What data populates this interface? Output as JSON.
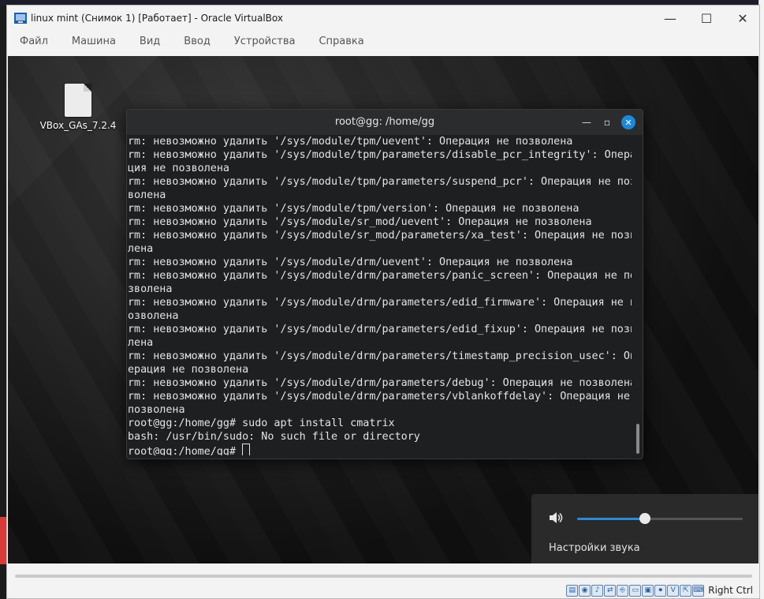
{
  "window": {
    "title": "linux mint (Снимок 1) [Работает] - Oracle VirtualBox",
    "minimize": "—",
    "maximize": "☐",
    "close": "✕"
  },
  "menu": [
    "Файл",
    "Машина",
    "Вид",
    "Ввод",
    "Устройства",
    "Справка"
  ],
  "desktop": {
    "icon_label": "VBox_GAs_7.2.4"
  },
  "terminal": {
    "title": "root@gg: /home/gg",
    "lines": [
      "rm: невозможно удалить '/sys/module/tpm/uevent': Операция не позволена",
      "rm: невозможно удалить '/sys/module/tpm/parameters/disable_pcr_integrity': Опера",
      "ция не позволена",
      "rm: невозможно удалить '/sys/module/tpm/parameters/suspend_pcr': Операция не поз",
      "волена",
      "rm: невозможно удалить '/sys/module/tpm/version': Операция не позволена",
      "rm: невозможно удалить '/sys/module/sr_mod/uevent': Операция не позволена",
      "rm: невозможно удалить '/sys/module/sr_mod/parameters/xa_test': Операция не позво",
      "лена",
      "rm: невозможно удалить '/sys/module/drm/uevent': Операция не позволена",
      "rm: невозможно удалить '/sys/module/drm/parameters/panic_screen': Операция не по",
      "зволена",
      "rm: невозможно удалить '/sys/module/drm/parameters/edid_firmware': Операция не п",
      "озволена",
      "rm: невозможно удалить '/sys/module/drm/parameters/edid_fixup': Операция не позво",
      "лена",
      "rm: невозможно удалить '/sys/module/drm/parameters/timestamp_precision_usec': Оп",
      "ерация не позволена",
      "rm: невозможно удалить '/sys/module/drm/parameters/debug': Операция не позволена",
      "rm: невозможно удалить '/sys/module/drm/parameters/vblankoffdelay': Операция не",
      "позволена",
      "root@gg:/home/gg# sudo apt install cmatrix",
      "bash: /usr/bin/sudo: No such file or directory"
    ],
    "prompt": "root@gg:/home/gg# "
  },
  "sound": {
    "label": "Настройки звука",
    "volume_percent": 41,
    "icon": "speaker-icon"
  },
  "statusbar": {
    "icons": [
      "hard-disk-icon",
      "optical-disk-icon",
      "audio-icon",
      "network-icon",
      "usb-icon",
      "shared-folder-icon",
      "display-icon",
      "recording-icon",
      "virtualization-icon",
      "mouse-integration-icon",
      "keyboard-icon"
    ],
    "host_key": "Right Ctrl"
  },
  "colors": {
    "accent": "#2a8ad8",
    "terminal_bg": "#1e1f21"
  }
}
